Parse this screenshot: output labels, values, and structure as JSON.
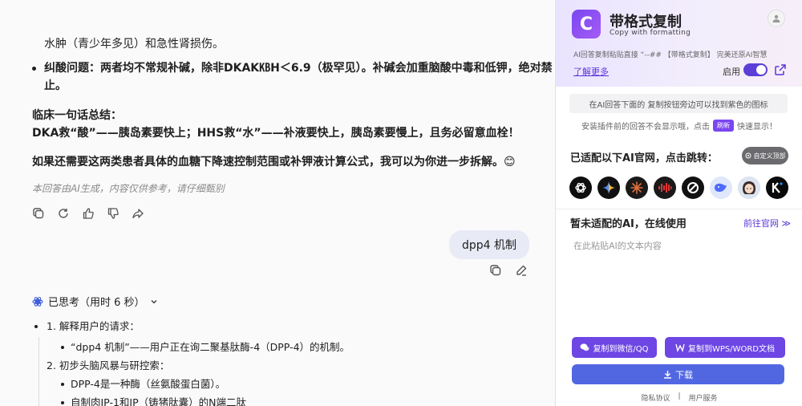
{
  "chat": {
    "lines": {
      "l1": "水肿（青少年多见）和急性肾损伤。",
      "l2": "纠酸问题：两者均不常规补碱，除非DKAK㎅H＜6.9（极罕见）。补碱会加重脑酸中毒和低钾，绝对禁",
      "l3": "止。",
      "l4": "临床一句话总结：",
      "l5": "DKA救“酸”——胰岛素要快上；HHS救“水”——补液要快上，胰岛素要慢上，且务必留意血栓！",
      "l6": "如果还需要这两类患者具体的血糖下降速控制范围或补钾液计算公式，我可以为你进一步拆解。😊"
    },
    "disclaimer": "本回答由AI生成，内容仅供参考，请仔细甄别",
    "user_message": "dpp4 机制",
    "thinking_label": "已思考（用时 6 秒）",
    "steps": {
      "s1": "1. 解释用户的请求：",
      "s1a": "“dpp4 机制”——用户正在询二聚基肽酶-4（DPP-4）的机制。",
      "s2": "2. 初步头脑风暴与研控索：",
      "s2a": "DPP-4是一种酶（丝氨酸蛋白菌）。",
      "s2b": "自制肉IP-1和IP（铸猪肽囊）的N端二肽"
    }
  },
  "panel": {
    "logo_letter": "C",
    "title": "带格式复制",
    "subtitle": "Copy with formatting",
    "description": "AI回答复制粘贴直接 “--## 【带格式复制】 完美还原AI智慧",
    "learn_more": "了解更多",
    "enable_label": "启用",
    "notice": "在AI回答下面的 复制按钮旁边可以找到紫色的图标",
    "hint_before": "安装插件前的回答不会显示哦，点击",
    "hint_tag": "刷新",
    "hint_after": "快速显示！",
    "adapted_title": "已适配以下AI官网，点击跳转：",
    "custom_button": "自定义顶部",
    "ai_sites": [
      "ChatGPT",
      "Gemini",
      "Claude",
      "豆包",
      "Perplexity",
      "DeepSeek",
      "Kimi",
      "Kimi Chat"
    ],
    "unadapted_title": "暂未适配的AI，在线使用",
    "goto_official": "前往官网 ≫",
    "textarea_placeholder": "在此粘贴AI的文本内容",
    "copy_wechat": "复制到微信/QQ",
    "copy_wps": "复制到WPS/WORD文档",
    "download": "下载",
    "footer": [
      "隐私协议",
      "用户服务"
    ]
  }
}
